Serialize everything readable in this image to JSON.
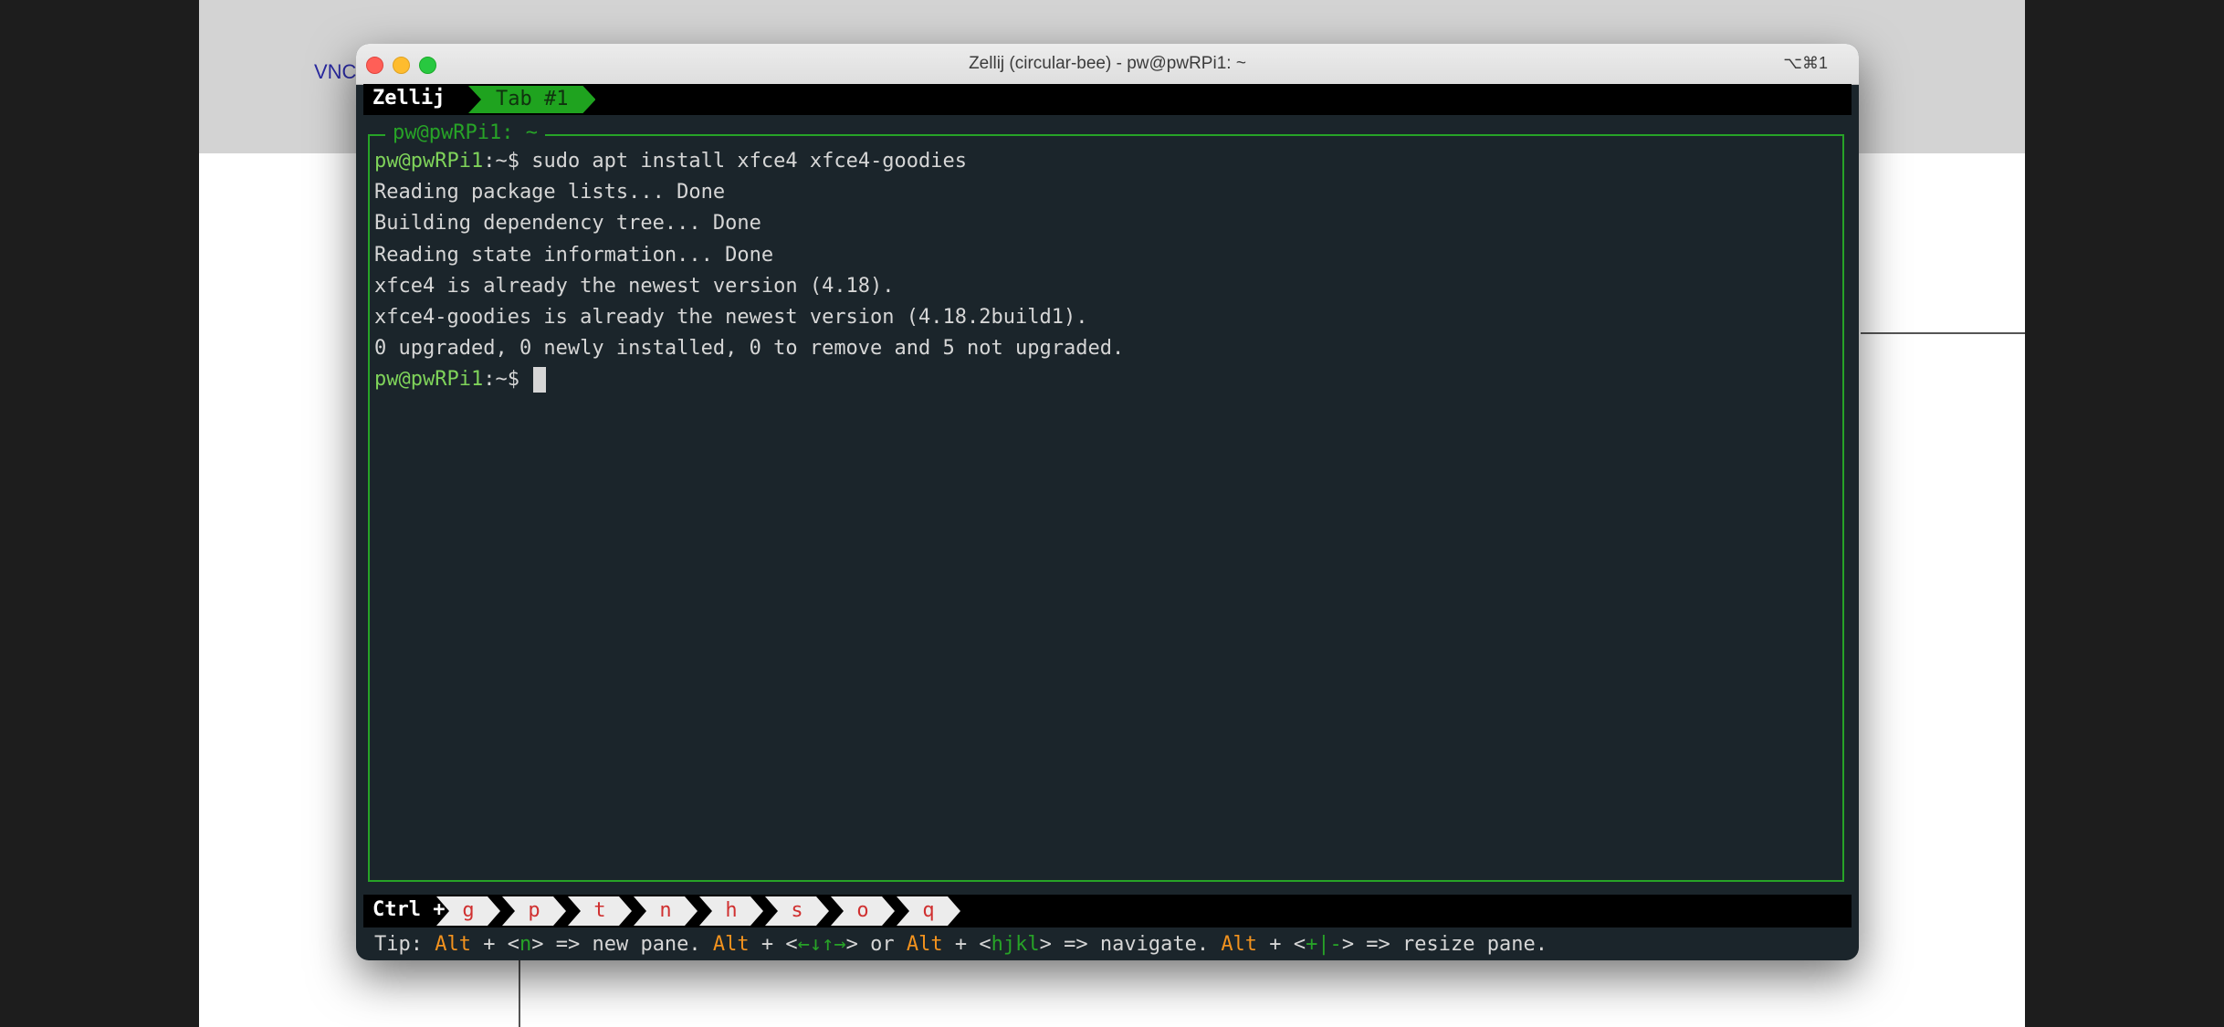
{
  "background": {
    "vnc_label": "VNC"
  },
  "window": {
    "title": "Zellij (circular-bee) - pw@pwRPi1: ~",
    "shortcut": "⌥⌘1"
  },
  "tabbar": {
    "app_label": "Zellij",
    "tab_label": "Tab #1"
  },
  "pane": {
    "title": "pw@pwRPi1: ~",
    "command": {
      "prompt_user": "pw@pwRPi1",
      "prompt_rest": ":~$ ",
      "text": "sudo apt install xfce4 xfce4-goodies"
    },
    "output": [
      "Reading package lists... Done",
      "Building dependency tree... Done",
      "Reading state information... Done",
      "xfce4 is already the newest version (4.18).",
      "xfce4-goodies is already the newest version (4.18.2build1).",
      "0 upgraded, 0 newly installed, 0 to remove and 5 not upgraded."
    ],
    "current_prompt": {
      "prompt_user": "pw@pwRPi1",
      "prompt_rest": ":~$ "
    }
  },
  "statusbar": {
    "modifier": "Ctrl +",
    "keys": [
      "g",
      "p",
      "t",
      "n",
      "h",
      "s",
      "o",
      "q"
    ]
  },
  "tip": {
    "prefix": "Tip: ",
    "alt": "Alt",
    "plus": " + ",
    "lt": "<",
    "gt": ">",
    "key_n": "n",
    "arrows": "←↓↑→",
    "hjkl": "hjkl",
    "resize_keys": "+|-",
    "new_pane": " => new pane. ",
    "or": " or ",
    "navigate": " => navigate. ",
    "resize": " => resize pane."
  },
  "colors": {
    "terminal_bg": "#1b252b",
    "accent_green": "#27a327",
    "key_red": "#d03030",
    "alt_orange": "#f2921e"
  }
}
